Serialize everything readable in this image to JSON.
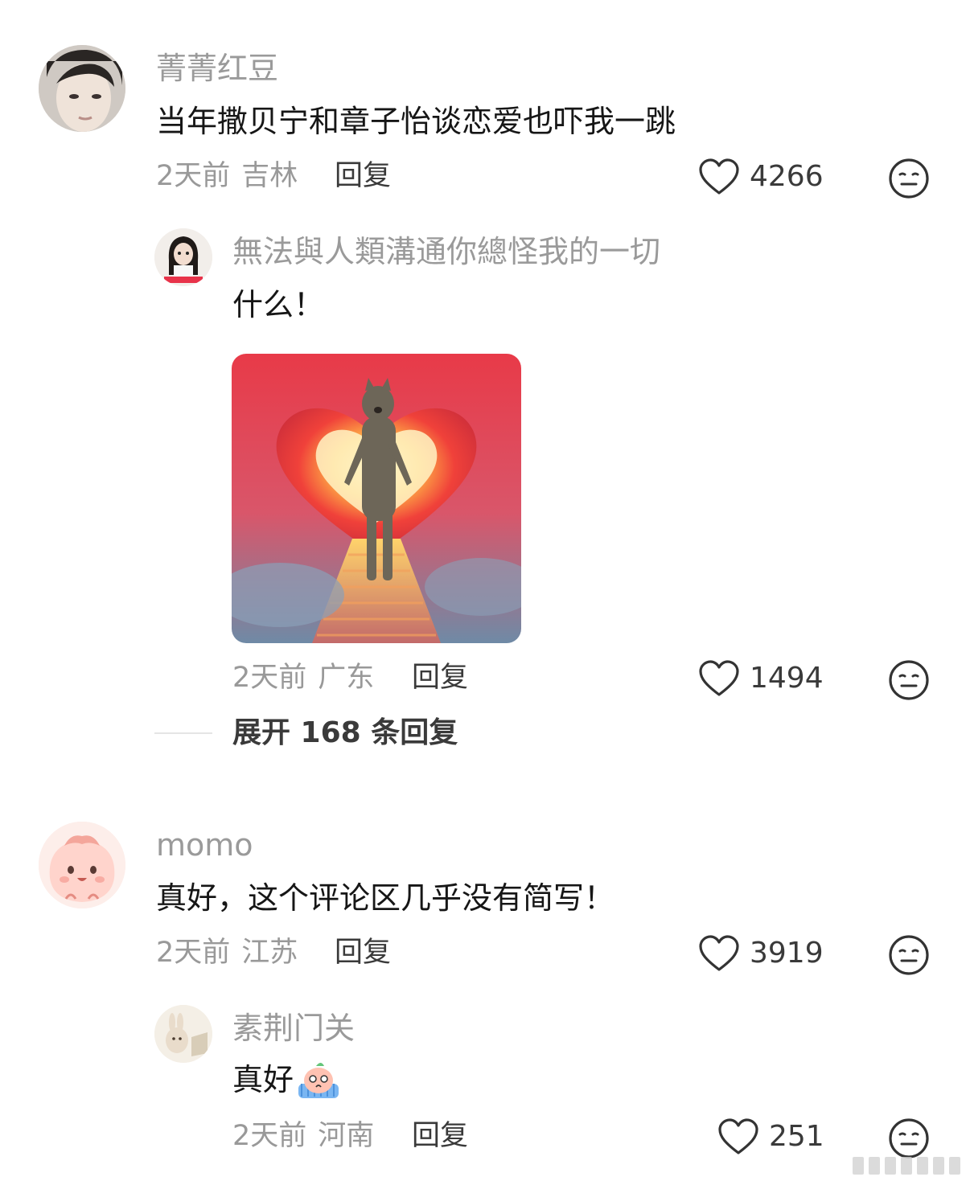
{
  "comments": [
    {
      "user": "菁菁红豆",
      "text": "当年撒贝宁和章子怡谈恋爱也吓我一跳",
      "time": "2天前",
      "location": "吉林",
      "reply_label": "回复",
      "likes": "4266",
      "replies": [
        {
          "user": "無法與人類溝通你總怪我的一切",
          "text": "什么！",
          "time": "2天前",
          "location": "广东",
          "reply_label": "回复",
          "likes": "1494"
        }
      ],
      "expand_label": "展开 168 条回复"
    },
    {
      "user": "momo",
      "text": "真好，这个评论区几乎没有简写！",
      "time": "2天前",
      "location": "江苏",
      "reply_label": "回复",
      "likes": "3919",
      "replies": [
        {
          "user": "素荆门关",
          "text": "真好",
          "time": "2天前",
          "location": "河南",
          "reply_label": "回复",
          "likes": "251"
        }
      ]
    }
  ],
  "icons": {
    "like": "heart-outline-icon",
    "reaction": "meh-face-icon"
  },
  "colors": {
    "username": "#9a9a9a",
    "meta": "#999999",
    "text": "#161616"
  }
}
